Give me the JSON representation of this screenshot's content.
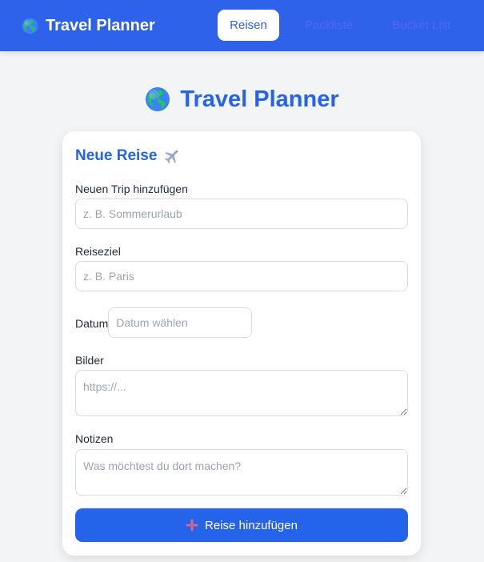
{
  "navbar": {
    "brand": "Travel Planner",
    "brand_icon": "globe-icon",
    "tabs": [
      {
        "label": "Reisen",
        "active": true
      },
      {
        "label": "Packliste",
        "active": false
      },
      {
        "label": "Bucket List",
        "active": false
      }
    ]
  },
  "hero": {
    "title": "Travel Planner",
    "icon": "globe-icon"
  },
  "form": {
    "title": "Neue Reise",
    "title_icon": "airplane-icon",
    "trip": {
      "label": "Neuen Trip hinzufügen",
      "placeholder": "z. B. Sommerurlaub",
      "value": ""
    },
    "destination": {
      "label": "Reiseziel",
      "placeholder": "z. B. Paris",
      "value": ""
    },
    "date": {
      "label": "Datum",
      "placeholder": "Datum wählen",
      "value": ""
    },
    "images": {
      "label": "Bilder",
      "placeholder": "https://...",
      "value": ""
    },
    "notes": {
      "label": "Notizen",
      "placeholder": "Was möchtest du dort machen?",
      "value": ""
    },
    "submit": {
      "label": "Reise hinzufügen",
      "icon": "plus-icon"
    }
  },
  "colors": {
    "navbar": "#2f62ea",
    "accent": "#2563eb",
    "background": "#f2f4f6",
    "inactive_tab": "#4e67f6",
    "plus_icon": "#e0628c"
  }
}
